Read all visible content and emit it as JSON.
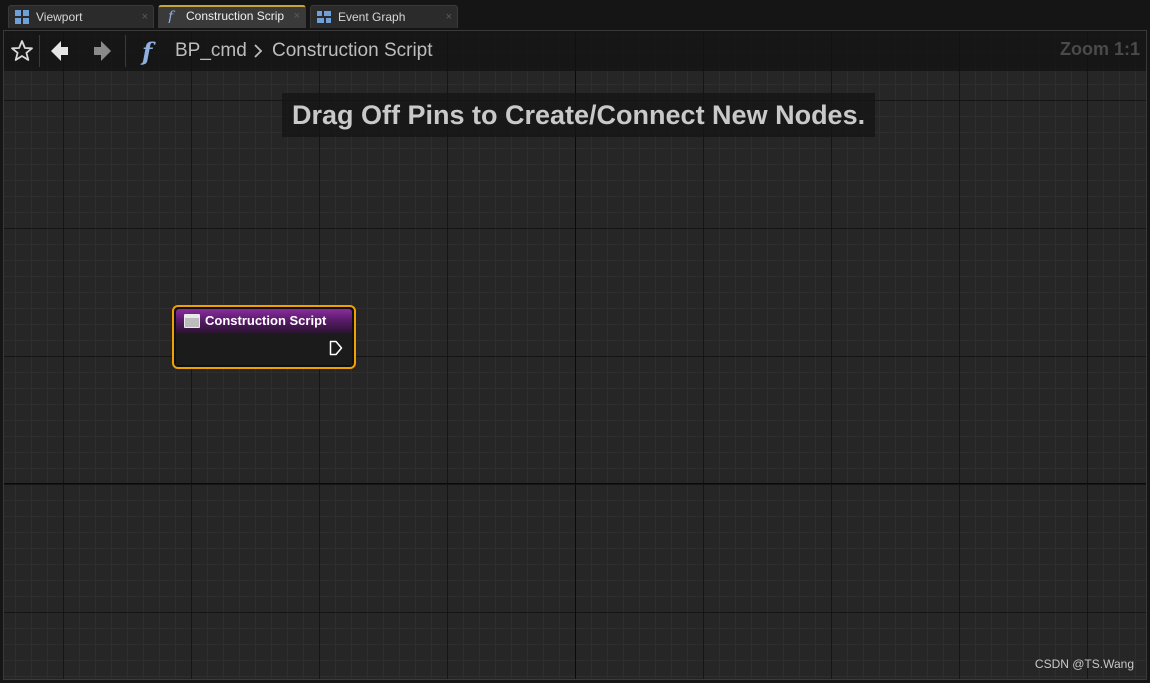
{
  "tabs": [
    {
      "label": "Viewport",
      "icon": "viewport-icon",
      "close": "×",
      "active": false
    },
    {
      "label": "Construction Scrip",
      "icon": "function-icon",
      "close": "×",
      "active": true
    },
    {
      "label": "Event Graph",
      "icon": "graph-icon",
      "close": "×",
      "active": false
    }
  ],
  "toolbar": {
    "favorite_icon": "star-icon",
    "back_icon": "arrow-left-icon",
    "forward_icon": "arrow-right-icon",
    "function_icon": "function-icon",
    "breadcrumb": [
      "BP_cmd",
      "Construction Script"
    ],
    "zoom": "Zoom 1:1"
  },
  "graph": {
    "hint": "Drag Off Pins to Create/Connect New Nodes.",
    "node": {
      "title": "Construction Script",
      "icon": "function-entry-icon",
      "pin_icon": "exec-pin-icon",
      "header_color": "#8a2d9e",
      "selection_color": "#f0a000"
    }
  },
  "watermark": "CSDN @TS.Wang",
  "colors": {
    "background": "#262626",
    "active_tab_accent": "#c7a53a"
  }
}
